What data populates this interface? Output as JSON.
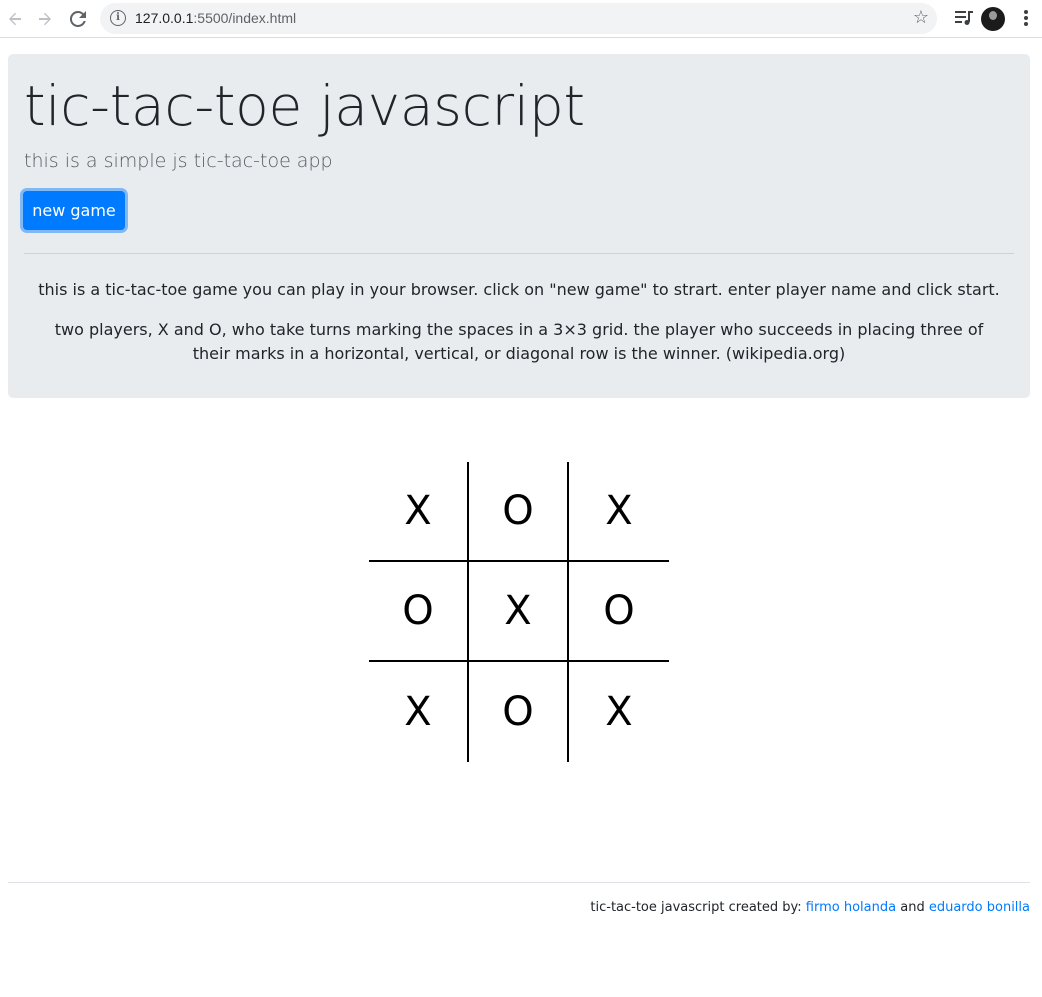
{
  "browser": {
    "url_host": "127.0.0.1",
    "url_path": ":5500/index.html"
  },
  "header": {
    "title": "tic-tac-toe javascript",
    "subtitle": "this is a simple js tic-tac-toe app",
    "new_game_label": "new game"
  },
  "description": {
    "para1": "this is a tic-tac-toe game you can play in your browser. click on \"new game\" to strart. enter player name and click start.",
    "para2": "two players, X and O, who take turns marking the spaces in a 3×3 grid. the player who succeeds in placing three of their marks in a horizontal, vertical, or diagonal row is the winner. (wikipedia.org)"
  },
  "board": {
    "cells": [
      "X",
      "O",
      "X",
      "O",
      "X",
      "O",
      "X",
      "O",
      "X"
    ]
  },
  "footer": {
    "prefix": "tic-tac-toe javascript created by:",
    "author1": "firmo holanda",
    "conjunction": "and",
    "author2": "eduardo bonilla"
  },
  "colors": {
    "primary": "#007bff",
    "jumbotron_bg": "#e9ecef"
  }
}
